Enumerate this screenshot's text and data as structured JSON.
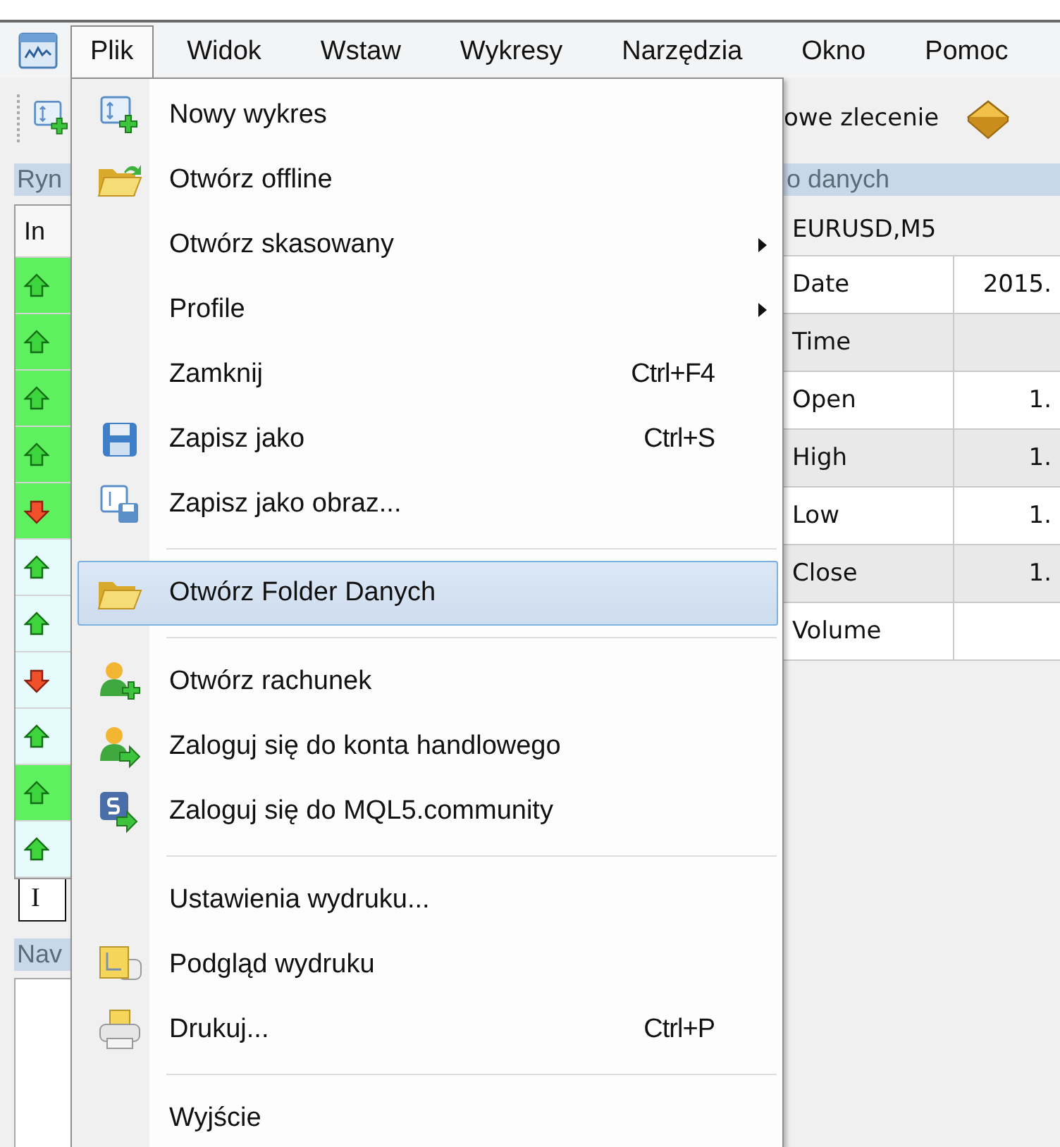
{
  "menu_bar": [
    {
      "label": "Plik",
      "selected": true
    },
    {
      "label": "Widok",
      "selected": false
    },
    {
      "label": "Wstaw",
      "selected": false
    },
    {
      "label": "Wykresy",
      "selected": false
    },
    {
      "label": "Narzędzia",
      "selected": false
    },
    {
      "label": "Okno",
      "selected": false
    },
    {
      "label": "Pomoc",
      "selected": false
    }
  ],
  "toolbar": {
    "order_button": "owe zlecenie"
  },
  "market_watch": {
    "title": "Ryn",
    "column": "In",
    "tab": "I",
    "rows": [
      {
        "kind": "up",
        "highlighted": true
      },
      {
        "kind": "up",
        "highlighted": true
      },
      {
        "kind": "up",
        "highlighted": true
      },
      {
        "kind": "up",
        "highlighted": true
      },
      {
        "kind": "down",
        "highlighted": true
      },
      {
        "kind": "up",
        "highlighted": false
      },
      {
        "kind": "up",
        "highlighted": false
      },
      {
        "kind": "down",
        "highlighted": false
      },
      {
        "kind": "up",
        "highlighted": false
      },
      {
        "kind": "up",
        "highlighted": true
      },
      {
        "kind": "up",
        "highlighted": false
      }
    ]
  },
  "navigator": {
    "title": "Nav"
  },
  "data_window": {
    "title": "o danych",
    "symbol": "EURUSD,M5",
    "rows": [
      {
        "label": "Date",
        "value": "2015."
      },
      {
        "label": "Time"
      },
      {
        "label": "Open",
        "value": "1."
      },
      {
        "label": "High",
        "value": "1."
      },
      {
        "label": "Low",
        "value": "1."
      },
      {
        "label": "Close",
        "value": "1."
      },
      {
        "label": "Volume"
      }
    ]
  },
  "file_menu": {
    "items": [
      {
        "kind": "chart",
        "label": "Nowy wykres",
        "submenu": false,
        "selected": false
      },
      {
        "kind": "offline",
        "label": "Otwórz offline",
        "submenu": false,
        "selected": false
      },
      {
        "kind": "text",
        "label": "Otwórz skasowany",
        "submenu": true,
        "selected": false
      },
      {
        "kind": "text",
        "label": "Profile",
        "submenu": true,
        "selected": false
      },
      {
        "kind": "text",
        "label": "Zamknij",
        "shortcut": "Ctrl+F4",
        "submenu": false,
        "selected": false
      },
      {
        "kind": "floppy",
        "label": "Zapisz jako",
        "shortcut": "Ctrl+S",
        "submenu": false,
        "selected": false
      },
      {
        "kind": "picture",
        "label": "Zapisz jako obraz...",
        "submenu": false,
        "selected": false
      },
      {
        "kind": "separator"
      },
      {
        "kind": "folder",
        "label": "Otwórz Folder Danych",
        "submenu": false,
        "selected": true
      },
      {
        "kind": "separator"
      },
      {
        "kind": "account",
        "label": "Otwórz rachunek",
        "submenu": false,
        "selected": false
      },
      {
        "kind": "login",
        "label": "Zaloguj się do konta handlowego",
        "submenu": false,
        "selected": false
      },
      {
        "kind": "community",
        "label": "Zaloguj się do MQL5.community",
        "submenu": false,
        "selected": false
      },
      {
        "kind": "separator"
      },
      {
        "kind": "text",
        "label": "Ustawienia wydruku...",
        "submenu": false,
        "selected": false
      },
      {
        "kind": "preview",
        "label": "Podgląd wydruku",
        "submenu": false,
        "selected": false
      },
      {
        "kind": "printer",
        "label": "Drukuj...",
        "shortcut": "Ctrl+P",
        "submenu": false,
        "selected": false
      },
      {
        "kind": "separator"
      },
      {
        "kind": "text",
        "label": "Wyjście",
        "submenu": false,
        "selected": false
      }
    ]
  }
}
